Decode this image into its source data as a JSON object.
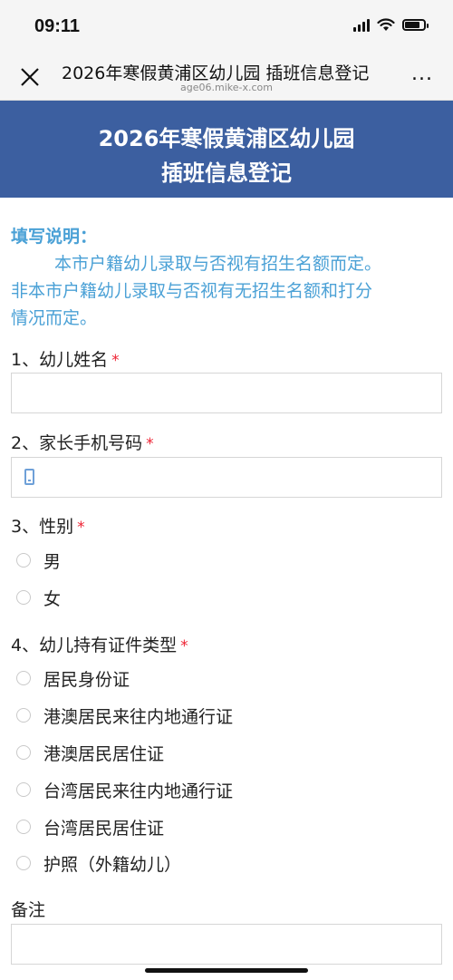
{
  "status_bar": {
    "time": "09:11"
  },
  "nav": {
    "title": "2026年寒假黄浦区幼儿园 插班信息登记",
    "url": "age06.mike-x.com",
    "more": "..."
  },
  "banner": {
    "line1": "2026年寒假黄浦区幼儿园",
    "line2": "插班信息登记"
  },
  "instructions": {
    "title": "填写说明：",
    "line1": "本市户籍幼儿录取与否视有招生名额而定。",
    "line2": "非本市户籍幼儿录取与否视有无招生名额和打分",
    "line3": "情况而定。"
  },
  "questions": {
    "q1": {
      "label": "1、幼儿姓名",
      "required": "*",
      "value": ""
    },
    "q2": {
      "label": "2、家长手机号码",
      "required": "*",
      "value": ""
    },
    "q3": {
      "label": "3、性别",
      "required": "*",
      "options": [
        "男",
        "女"
      ]
    },
    "q4": {
      "label": "4、幼儿持有证件类型",
      "required": "*",
      "options": [
        "居民身份证",
        "港澳居民来往内地通行证",
        "港澳居民居住证",
        "台湾居民来往内地通行证",
        "台湾居民居住证",
        "护照（外籍幼儿）"
      ]
    },
    "notes": {
      "label": "备注",
      "value": ""
    }
  }
}
